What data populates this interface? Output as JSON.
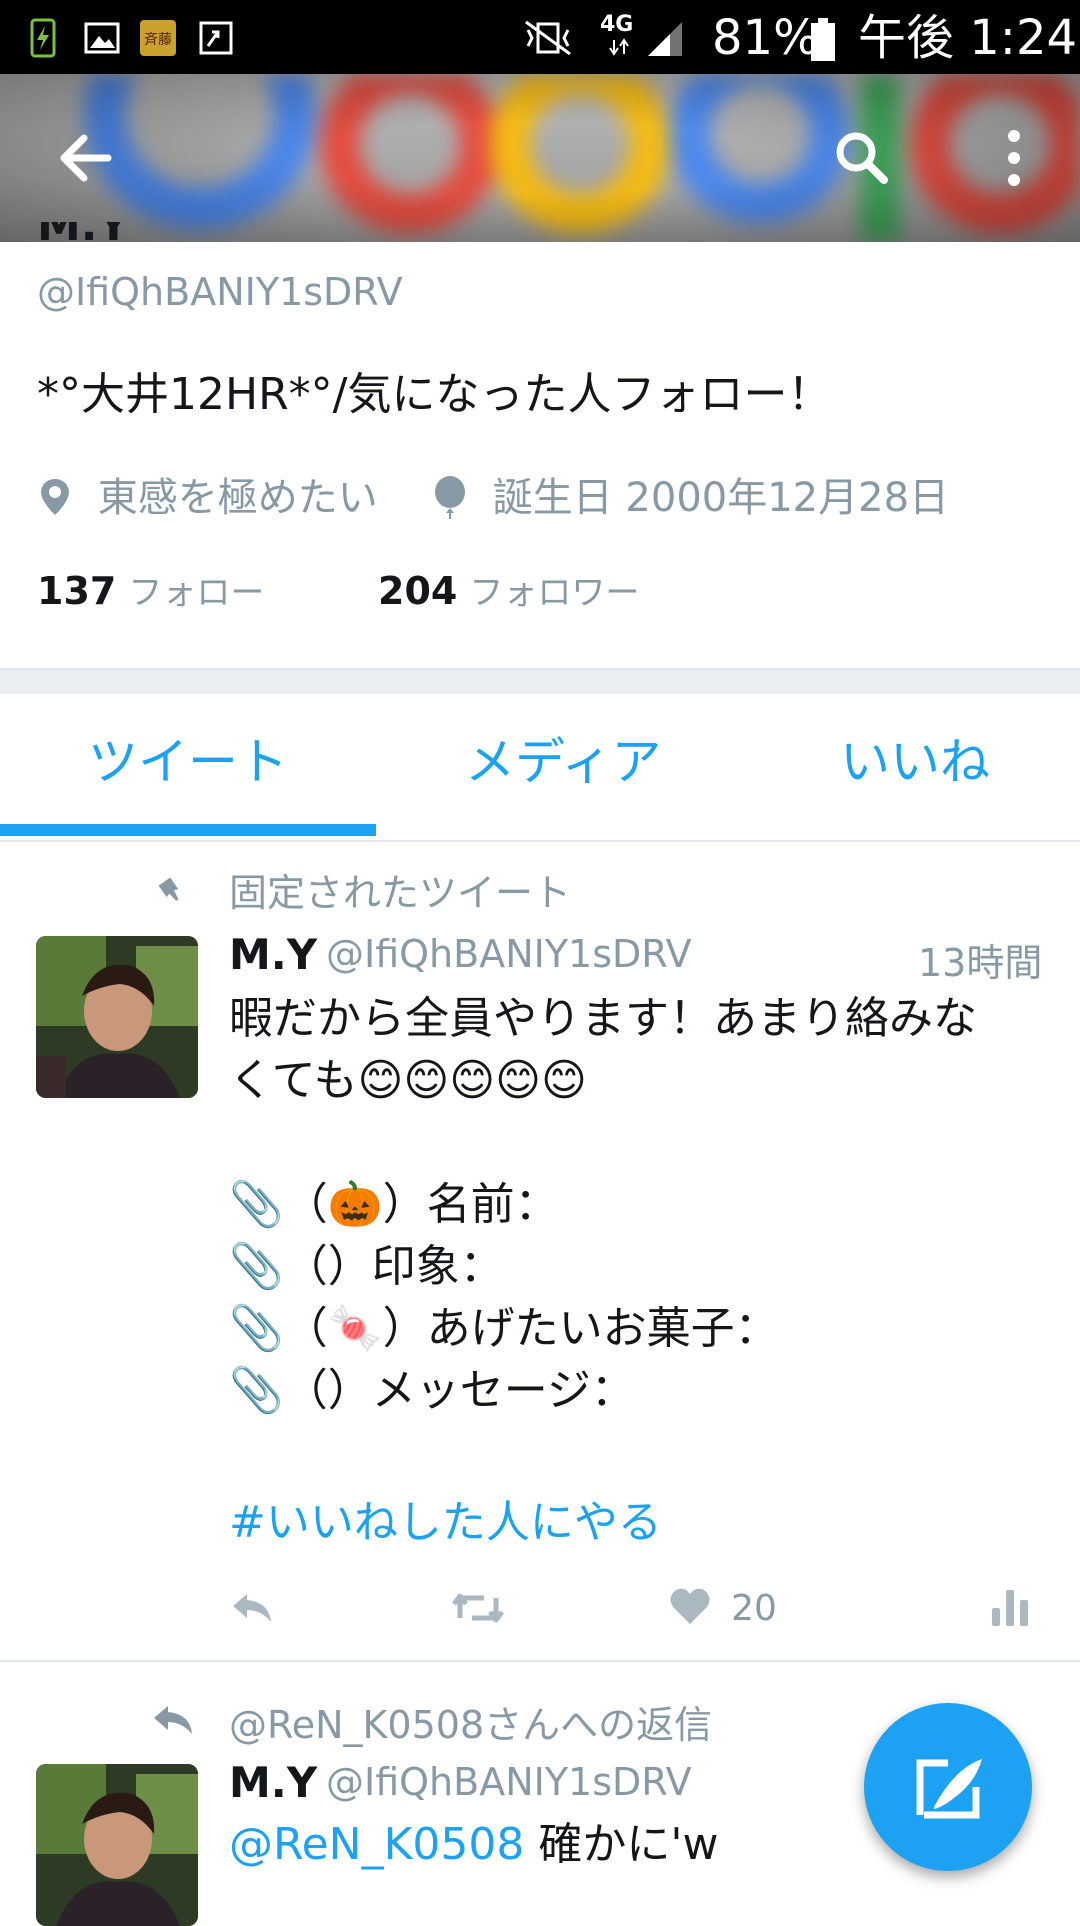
{
  "status_bar": {
    "battery": "81%",
    "time": "午後 1:24",
    "network": "4G"
  },
  "profile": {
    "name_partial": "M.Y",
    "handle": "@IfiQhBANIY1sDRV",
    "bio": "*°大井12HR*°/気になった人フォロー！",
    "location": "東感を極めたい",
    "birthday": "誕生日 2000年12月28日",
    "following_count": "137",
    "following_label": "フォロー",
    "followers_count": "204",
    "followers_label": "フォロワー"
  },
  "tabs": [
    {
      "label": "ツイート",
      "active": true
    },
    {
      "label": "メディア",
      "active": false
    },
    {
      "label": "いいね",
      "active": false
    }
  ],
  "tweets": [
    {
      "context": "固定されたツイート",
      "name": "M.Y",
      "handle": "@IfiQhBANIY1sDRV",
      "time": "13時間",
      "lines": [
        "暇だから全員やります！あまり絡みな",
        "くても😊😊😊😊😊",
        "",
        "📎（🎃）名前：",
        "📎（）印象：",
        "📎（🍬）あげたいお菓子：",
        "📎（）メッセージ："
      ],
      "hashtag": "#いいねした人にやる",
      "like_count": "20"
    },
    {
      "context": "@ReN_K0508さんへの返信",
      "name": "M.Y",
      "handle": "@IfiQhBANIY1sDRV",
      "mention": "@ReN_K0508",
      "text": " 確かに'w"
    }
  ],
  "colors": {
    "accent": "#1da1f2",
    "secondary_text": "#8899a6",
    "primary_text": "#14171a"
  }
}
